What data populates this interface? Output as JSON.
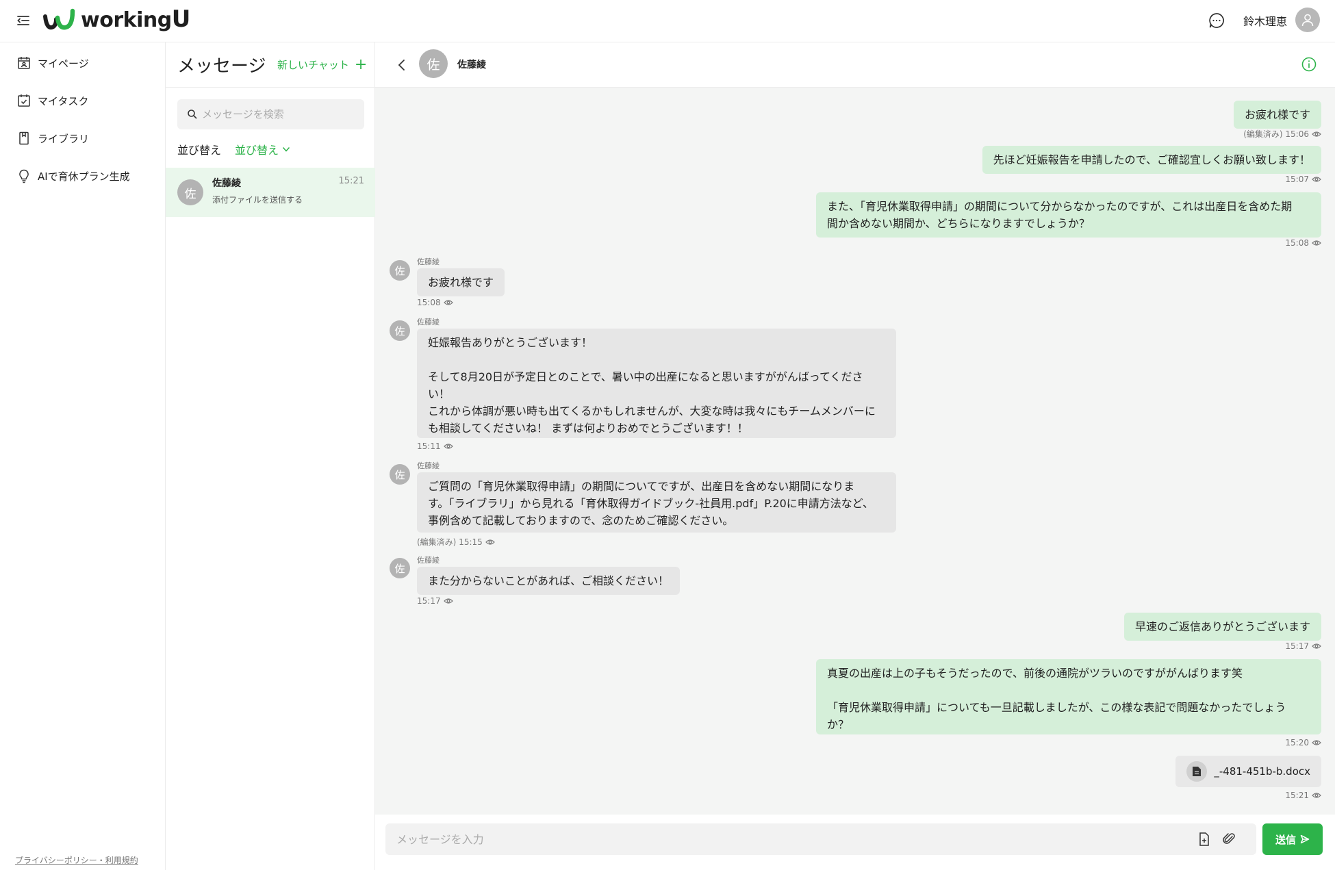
{
  "app": {
    "logo_text": "working",
    "logo_u": "U",
    "user_name": "鈴木理恵",
    "accent_color": "#2db34a"
  },
  "sidebar": {
    "items": [
      {
        "label": "マイページ",
        "icon": "calendar-user-icon"
      },
      {
        "label": "マイタスク",
        "icon": "calendar-check-icon"
      },
      {
        "label": "ライブラリ",
        "icon": "book-icon"
      },
      {
        "label": "AIで育休プラン生成",
        "icon": "lightbulb-icon"
      }
    ],
    "footer": "プライバシーポリシー・利用規約"
  },
  "list": {
    "title": "メッセージ",
    "new_chat": "新しいチャット",
    "search_placeholder": "メッセージを検索",
    "sort_label": "並び替え",
    "sort_value": "並び替え",
    "conversations": [
      {
        "avatar": "佐",
        "name": "佐藤綾",
        "time": "15:21",
        "preview": "添付ファイルを送信する"
      }
    ]
  },
  "chat": {
    "partner_name": "佐藤綾",
    "partner_avatar": "佐",
    "messages": [
      {
        "text": "お疲れ様です",
        "meta": "(編集済み) 15:06"
      },
      {
        "text": "先ほど妊娠報告を申請したので、ご確認宜しくお願い致します！",
        "meta": "15:07"
      },
      {
        "text": "また、「育児休業取得申請」の期間について分からなかったのですが、これは出産日を含めた期\n間か含めない期間か、どちらになりますでしょうか？",
        "meta": "15:08"
      },
      {
        "sender": "佐藤綾",
        "text": "お疲れ様です",
        "meta": "15:08"
      },
      {
        "sender": "佐藤綾",
        "text": "妊娠報告ありがとうございます！\n\nそして8月20日が予定日とのことで、暑い中の出産になると思いますががんばってくださ\nい！\nこれから体調が悪い時も出てくるかもしれませんが、大変な時は我々にもチームメンバーに\nも相談してくださいね！ まずは何よりおめでとうございます！！",
        "meta": "15:11"
      },
      {
        "sender": "佐藤綾",
        "text": "ご質問の「育児休業取得申請」の期間についてですが、出産日を含めない期間になりま\nす。「ライブラリ」から見れる「育休取得ガイドブック-社員用.pdf」P.20に申請方法など、\n事例含めて記載しておりますので、念のためご確認ください。",
        "meta": "(編集済み) 15:15"
      },
      {
        "sender": "佐藤綾",
        "text": "また分からないことがあれば、ご相談ください！",
        "meta": "15:17"
      },
      {
        "text": "早速のご返信ありがとうございます",
        "meta": "15:17"
      },
      {
        "text": "真夏の出産は上の子もそうだったので、前後の通院がツラいのですががんばります笑\n\n「育児休業取得申請」についても一旦記載しましたが、この様な表記で問題なかったでしょう\nか？",
        "meta": "15:20"
      },
      {
        "file": "_-481-451b-b.docx",
        "meta": "15:21"
      }
    ],
    "composer_placeholder": "メッセージを入力",
    "send_label": "送信"
  }
}
